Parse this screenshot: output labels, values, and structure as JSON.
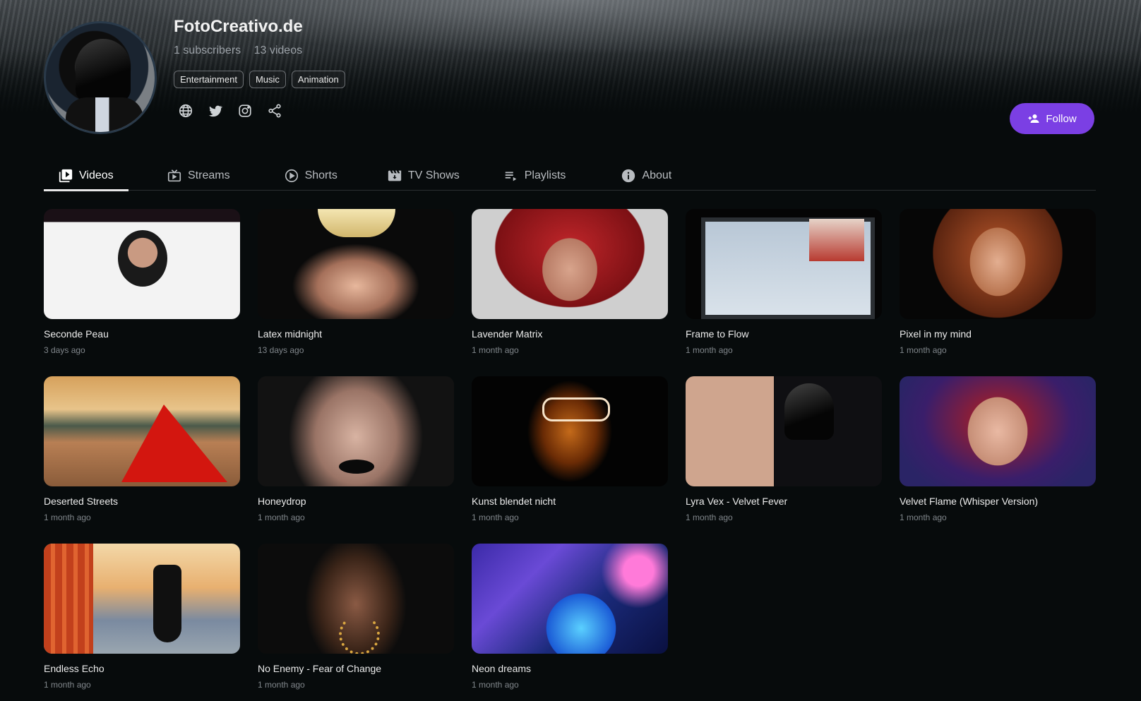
{
  "channel": {
    "name": "FotoCreativo.de",
    "subscribers": "1 subscribers",
    "videos_count": "13 videos",
    "tags": [
      "Entertainment",
      "Music",
      "Animation"
    ],
    "follow_label": "Follow",
    "accent": "#7b3fe4"
  },
  "socials": [
    {
      "icon": "globe-icon"
    },
    {
      "icon": "twitter-icon"
    },
    {
      "icon": "instagram-icon"
    },
    {
      "icon": "share-icon"
    }
  ],
  "tabs": [
    {
      "label": "Videos",
      "icon": "video-library-icon",
      "active": true
    },
    {
      "label": "Streams",
      "icon": "live-tv-icon",
      "active": false
    },
    {
      "label": "Shorts",
      "icon": "play-circle-icon",
      "active": false
    },
    {
      "label": "TV Shows",
      "icon": "movie-icon",
      "active": false
    },
    {
      "label": "Playlists",
      "icon": "playlist-icon",
      "active": false
    },
    {
      "label": "About",
      "icon": "info-icon",
      "active": false
    }
  ],
  "videos": [
    {
      "title": "Seconde Peau",
      "date": "3 days ago"
    },
    {
      "title": "Latex midnight",
      "date": "13 days ago"
    },
    {
      "title": "Lavender Matrix",
      "date": "1 month ago"
    },
    {
      "title": "Frame to Flow",
      "date": "1 month ago"
    },
    {
      "title": "Pixel in my mind",
      "date": "1 month ago"
    },
    {
      "title": "Deserted Streets",
      "date": "1 month ago"
    },
    {
      "title": "Honeydrop",
      "date": "1 month ago"
    },
    {
      "title": "Kunst blendet nicht",
      "date": "1 month ago"
    },
    {
      "title": "Lyra Vex - Velvet Fever",
      "date": "1 month ago"
    },
    {
      "title": "Velvet Flame (Whisper Version)",
      "date": "1 month ago"
    },
    {
      "title": "Endless Echo",
      "date": "1 month ago"
    },
    {
      "title": "No Enemy - Fear of Change",
      "date": "1 month ago"
    },
    {
      "title": "Neon dreams",
      "date": "1 month ago"
    }
  ]
}
